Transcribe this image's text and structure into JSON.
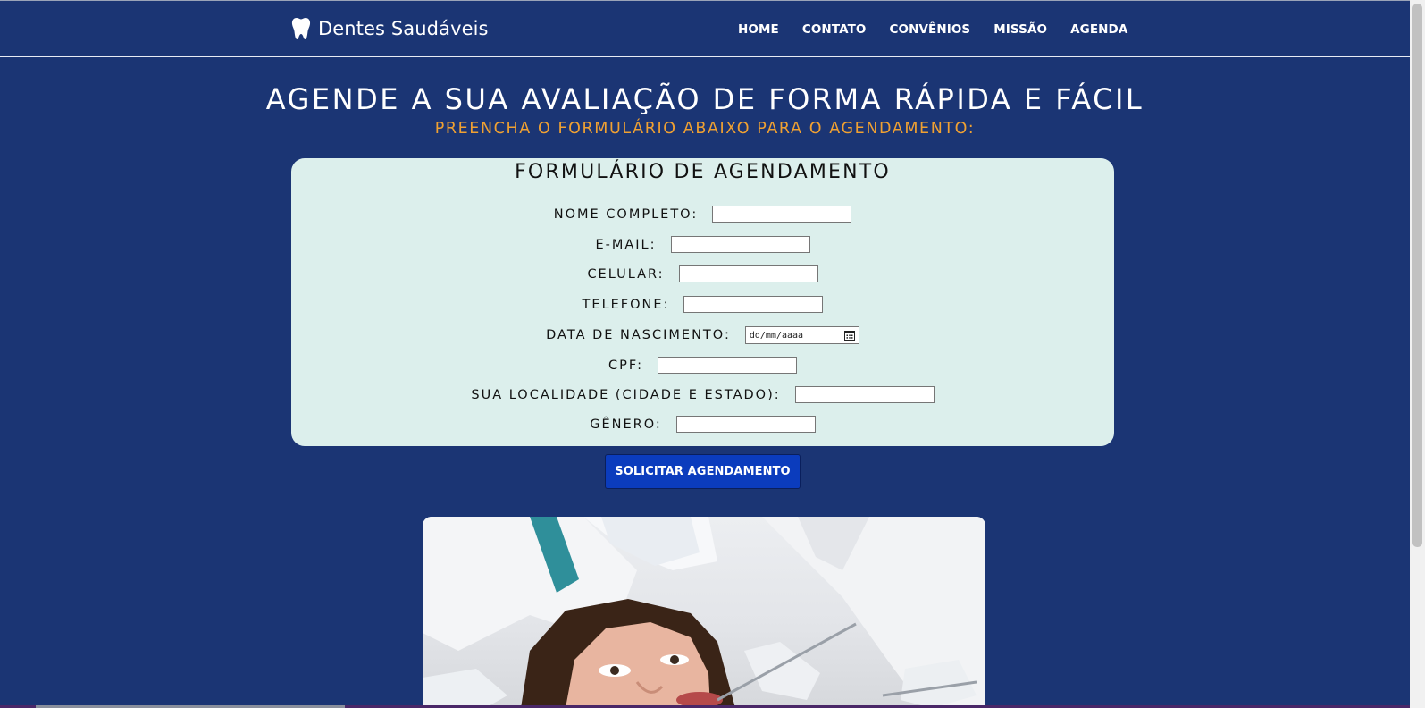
{
  "header": {
    "brand_name": "Dentes Saudáveis",
    "logo_icon": "tooth-icon",
    "nav": [
      "HOME",
      "CONTATO",
      "CONVÊNIOS",
      "MISSÃO",
      "AGENDA"
    ]
  },
  "hero": {
    "title": "AGENDE A SUA AVALIAÇÃO DE FORMA RÁPIDA E FÁCIL",
    "subtitle": "PREENCHA O FORMULÁRIO ABAIXO PARA O AGENDAMENTO:"
  },
  "form": {
    "title": "FORMULÁRIO DE AGENDAMENTO",
    "fields": [
      {
        "label": "NOME COMPLETO:",
        "value": ""
      },
      {
        "label": "E-MAIL:",
        "value": ""
      },
      {
        "label": "CELULAR:",
        "value": ""
      },
      {
        "label": "TELEFONE:",
        "value": ""
      },
      {
        "label": "DATA DE NASCIMENTO:",
        "placeholder": "dd/mm/aaaa"
      },
      {
        "label": "CPF:",
        "value": ""
      },
      {
        "label": "SUA LOCALIDADE (CIDADE E ESTADO):",
        "value": ""
      },
      {
        "label": "GÊNERO:",
        "value": ""
      }
    ],
    "submit_label": "SOLICITAR AGENDAMENTO"
  },
  "colors": {
    "background": "#1b3574",
    "accent_subtitle": "#f0a132",
    "form_card": "#dcefec",
    "button": "#0b3cbd"
  }
}
